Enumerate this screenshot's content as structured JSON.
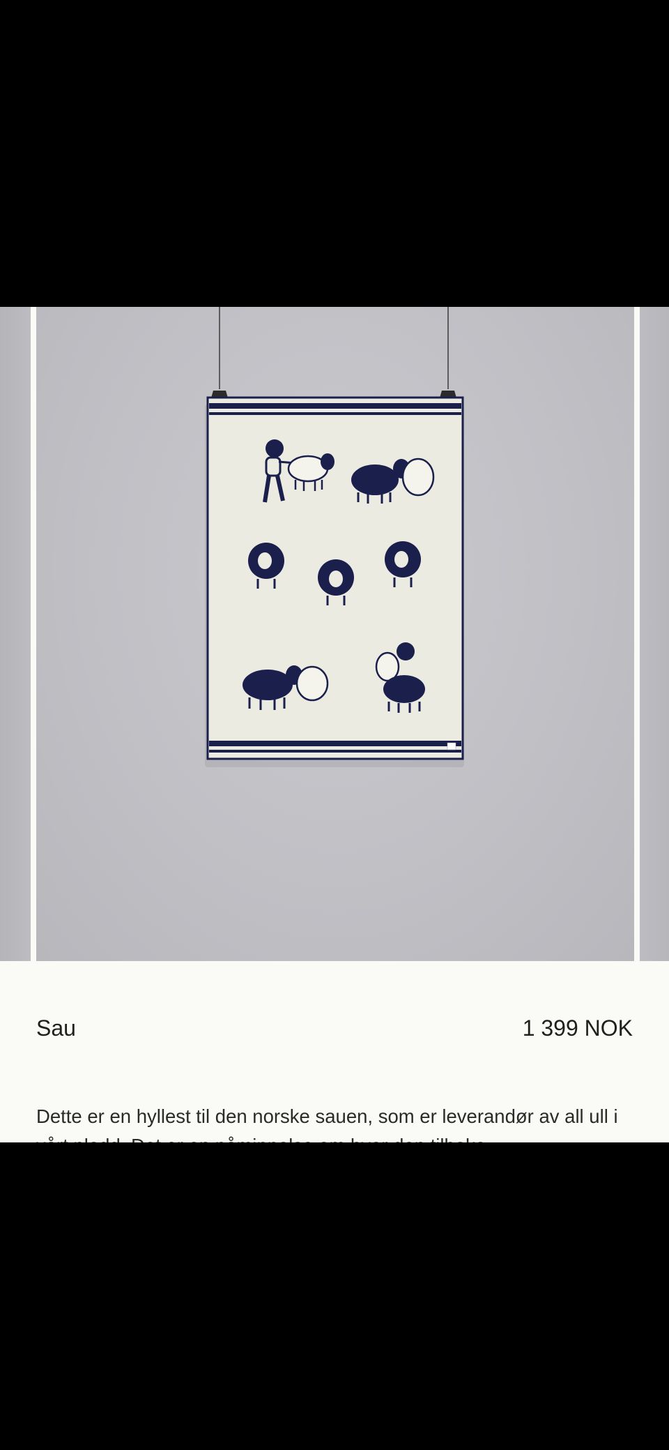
{
  "product": {
    "title": "Sau",
    "price": "1 399 NOK",
    "description": "Dette er en hyllest til den norske sauen, som er leverandør av all ull i vårt pledd. Det er en påminnelse om hvor den tilbake"
  },
  "gallery": {
    "image_subject": "wool-blanket-with-sheep-motif"
  },
  "colors": {
    "background": "#fafaf7",
    "text": "#1f1f1f",
    "blanket_navy": "#1b1f4b",
    "blanket_cream": "#ecebe2",
    "wall_grey": "#c4c4c9"
  }
}
